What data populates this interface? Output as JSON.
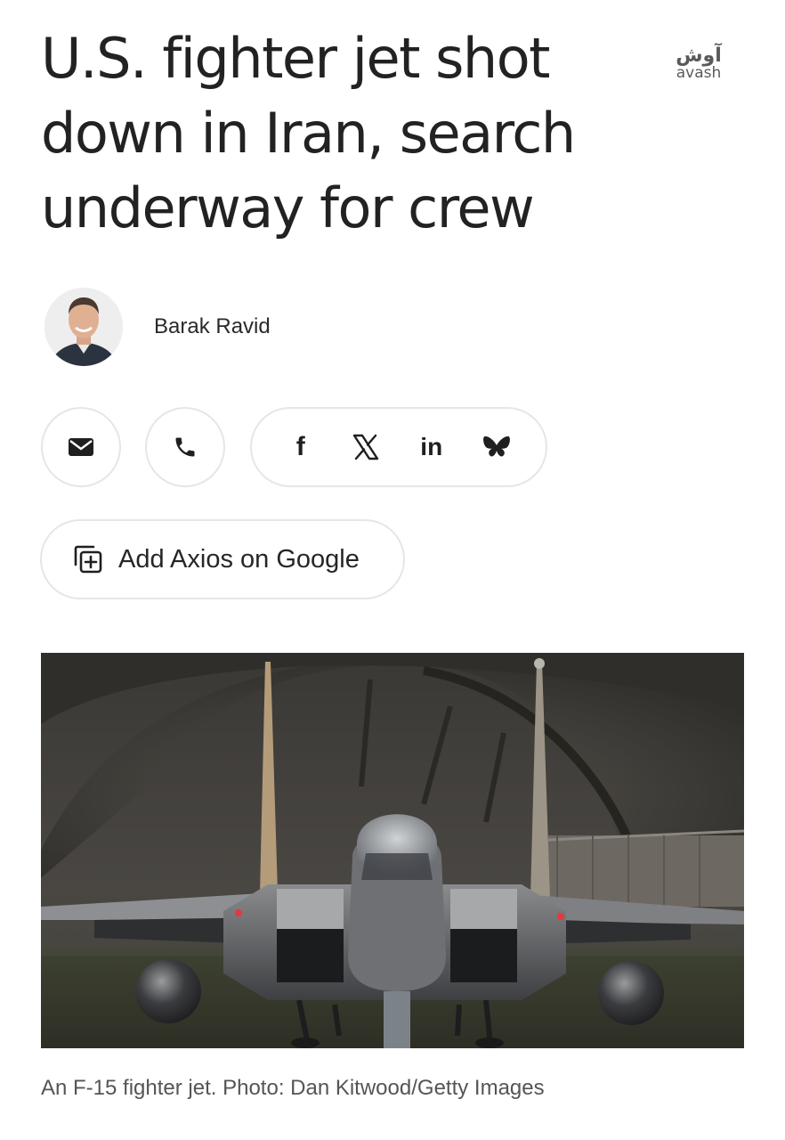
{
  "article": {
    "headline_lines": [
      "U.S. fighter jet shot",
      "down in Iran, search",
      "underway for crew"
    ],
    "author": "Barak Ravid"
  },
  "brand": {
    "name_fa": "آوش",
    "name_en": "avash"
  },
  "share": {
    "icons": [
      "email-icon",
      "phone-icon",
      "facebook-icon",
      "x-icon",
      "linkedin-icon",
      "bluesky-icon"
    ],
    "facebook_glyph": "f",
    "linkedin_glyph": "in"
  },
  "cta": {
    "add_google_label": "Add Axios on Google"
  },
  "image": {
    "caption": "An F-15 fighter jet. Photo: Dan Kitwood/Getty Images"
  }
}
